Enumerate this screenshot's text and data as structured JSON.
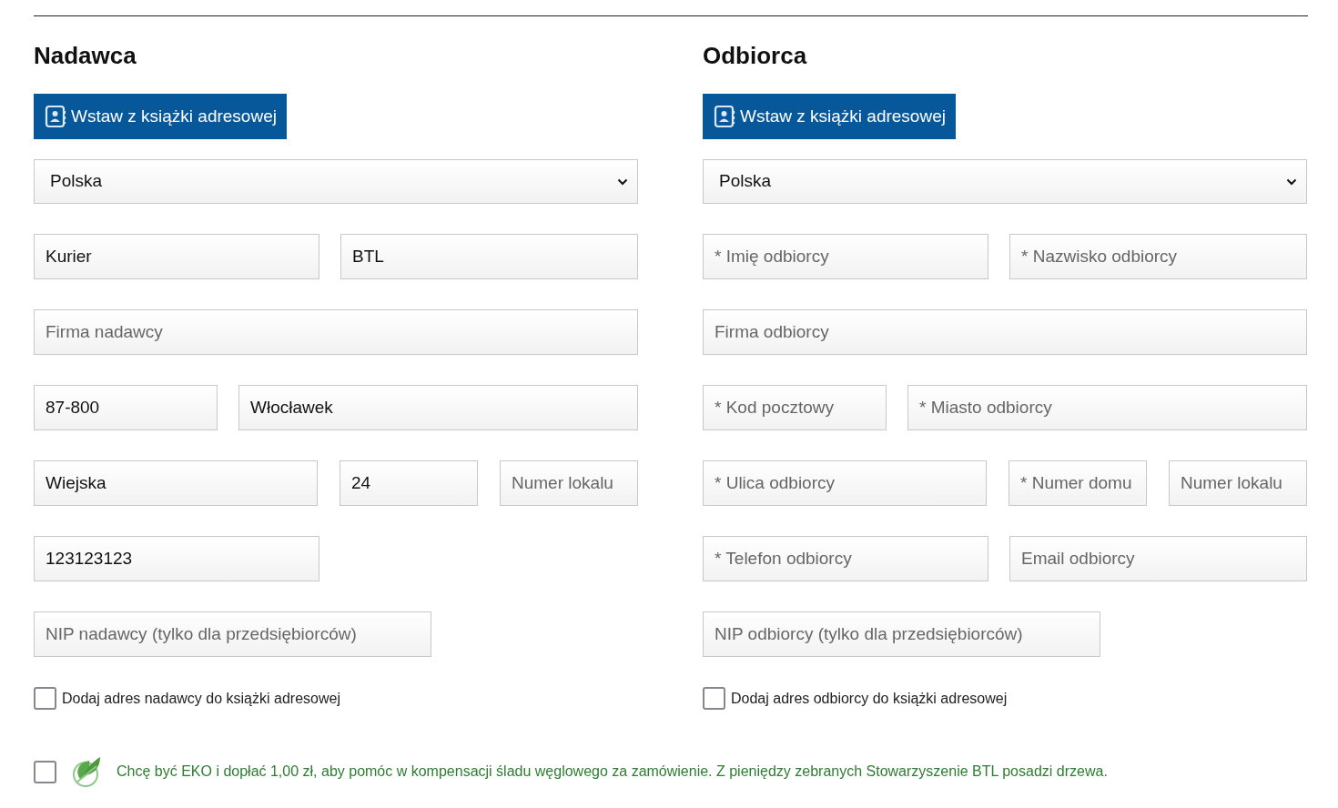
{
  "columns": [
    {
      "title": "Nadawca",
      "address_book_button": "Wstaw z książki adresowej",
      "country": "Polska",
      "rows": [
        [
          {
            "value": "Kurier"
          },
          {
            "value": "BTL"
          }
        ],
        [
          {
            "placeholder": "Firma nadawcy"
          }
        ],
        [
          {
            "value": "87-800"
          },
          {
            "value": "Włocławek"
          }
        ],
        [
          {
            "value": "Wiejska"
          },
          {
            "value": "24"
          },
          {
            "placeholder": "Numer lokalu"
          }
        ],
        [
          {
            "value": "123123123"
          }
        ],
        [
          {
            "placeholder": "NIP nadawcy (tylko dla przedsiębiorców)"
          }
        ]
      ],
      "save_checkbox": {
        "label": "Dodaj adres nadawcy do książki adresowej",
        "checked": false
      }
    },
    {
      "title": "Odbiorca",
      "address_book_button": "Wstaw z książki adresowej",
      "country": "Polska",
      "rows": [
        [
          {
            "placeholder": "* Imię odbiorcy"
          },
          {
            "placeholder": "* Nazwisko odbiorcy"
          }
        ],
        [
          {
            "placeholder": "Firma odbiorcy"
          }
        ],
        [
          {
            "placeholder": "* Kod pocztowy"
          },
          {
            "placeholder": "* Miasto odbiorcy"
          }
        ],
        [
          {
            "placeholder": "* Ulica odbiorcy"
          },
          {
            "placeholder": "* Numer domu"
          },
          {
            "placeholder": "Numer lokalu"
          }
        ],
        [
          {
            "placeholder": "* Telefon odbiorcy"
          },
          {
            "placeholder": "Email odbiorcy"
          }
        ],
        [
          {
            "placeholder": "NIP odbiorcy (tylko dla przedsiębiorców)"
          }
        ]
      ],
      "save_checkbox": {
        "label": "Dodaj adres odbiorcy do książki adresowej",
        "checked": false
      }
    }
  ],
  "eco_option": {
    "label": "Chcę być EKO i dopłać 1,00 zł, aby pomóc w kompensacji śladu węglowego za zamówienie. Z pieniędzy zebranych Stowarzyszenie BTL posadzi drzewa.",
    "checked": false
  }
}
